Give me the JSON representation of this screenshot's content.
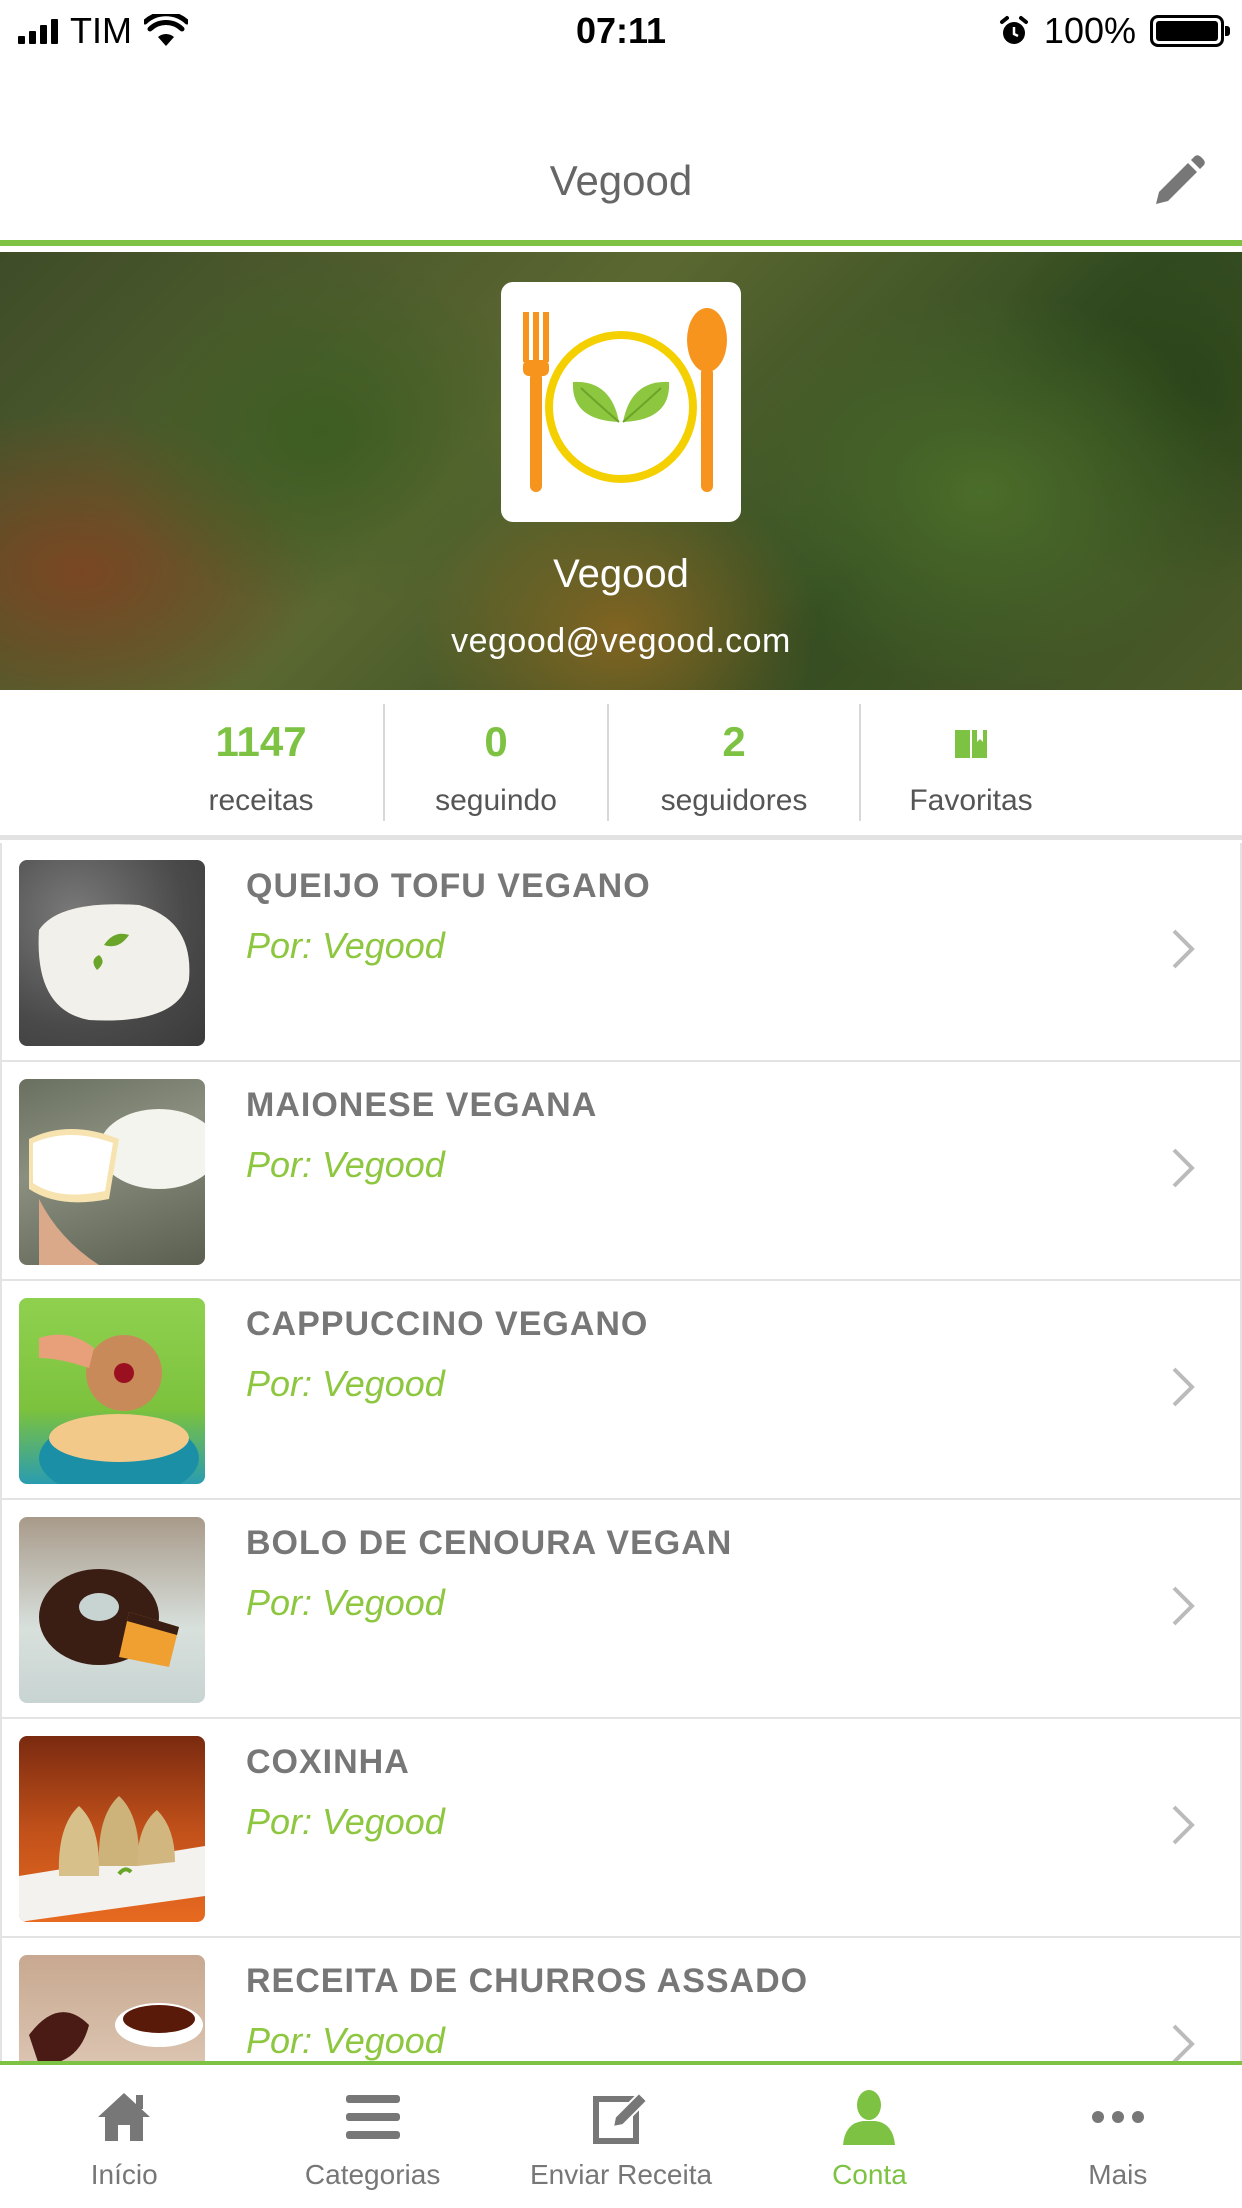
{
  "status_bar": {
    "carrier": "TIM",
    "time": "07:11",
    "battery": "100%"
  },
  "nav": {
    "title": "Vegood"
  },
  "profile": {
    "name": "Vegood",
    "email": "vegood@vegood.com"
  },
  "stats": [
    {
      "value": "1147",
      "label": "receitas"
    },
    {
      "value": "0",
      "label": "seguindo"
    },
    {
      "value": "2",
      "label": "seguidores"
    },
    {
      "label": "Favoritas",
      "icon": "book-icon"
    }
  ],
  "recipes": [
    {
      "title": "QUEIJO TOFU VEGANO",
      "author": "Por: Vegood"
    },
    {
      "title": "MAIONESE VEGANA",
      "author": "Por: Vegood"
    },
    {
      "title": "CAPPUCCINO VEGANO",
      "author": "Por: Vegood"
    },
    {
      "title": "BOLO DE CENOURA VEGAN",
      "author": "Por: Vegood"
    },
    {
      "title": "COXINHA",
      "author": "Por: Vegood"
    },
    {
      "title": "RECEITA DE CHURROS ASSADO",
      "author": "Por: Vegood"
    }
  ],
  "tabs": [
    {
      "label": "Início",
      "icon": "home-icon"
    },
    {
      "label": "Categorias",
      "icon": "menu-icon"
    },
    {
      "label": "Enviar Receita",
      "icon": "edit-icon"
    },
    {
      "label": "Conta",
      "icon": "user-icon",
      "active": true
    },
    {
      "label": "Mais",
      "icon": "more-icon"
    }
  ],
  "colors": {
    "accent": "#7dc242",
    "text_gray": "#777777"
  }
}
